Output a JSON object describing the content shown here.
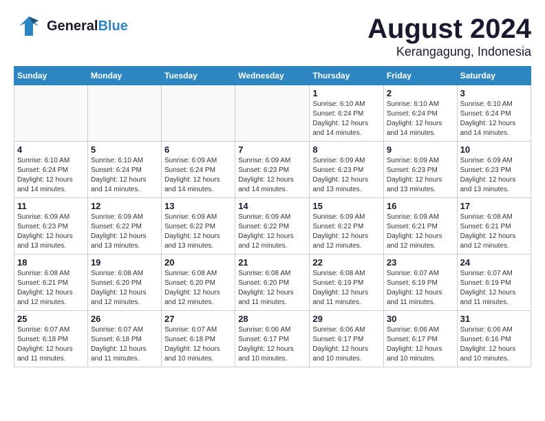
{
  "header": {
    "logo_general": "General",
    "logo_blue": "Blue",
    "month_year": "August 2024",
    "location": "Kerangagung, Indonesia"
  },
  "weekdays": [
    "Sunday",
    "Monday",
    "Tuesday",
    "Wednesday",
    "Thursday",
    "Friday",
    "Saturday"
  ],
  "weeks": [
    [
      {
        "day": "",
        "info": "",
        "empty": true
      },
      {
        "day": "",
        "info": "",
        "empty": true
      },
      {
        "day": "",
        "info": "",
        "empty": true
      },
      {
        "day": "",
        "info": "",
        "empty": true
      },
      {
        "day": "1",
        "info": "Sunrise: 6:10 AM\nSunset: 6:24 PM\nDaylight: 12 hours\nand 14 minutes.",
        "empty": false
      },
      {
        "day": "2",
        "info": "Sunrise: 6:10 AM\nSunset: 6:24 PM\nDaylight: 12 hours\nand 14 minutes.",
        "empty": false
      },
      {
        "day": "3",
        "info": "Sunrise: 6:10 AM\nSunset: 6:24 PM\nDaylight: 12 hours\nand 14 minutes.",
        "empty": false
      }
    ],
    [
      {
        "day": "4",
        "info": "Sunrise: 6:10 AM\nSunset: 6:24 PM\nDaylight: 12 hours\nand 14 minutes.",
        "empty": false
      },
      {
        "day": "5",
        "info": "Sunrise: 6:10 AM\nSunset: 6:24 PM\nDaylight: 12 hours\nand 14 minutes.",
        "empty": false
      },
      {
        "day": "6",
        "info": "Sunrise: 6:09 AM\nSunset: 6:24 PM\nDaylight: 12 hours\nand 14 minutes.",
        "empty": false
      },
      {
        "day": "7",
        "info": "Sunrise: 6:09 AM\nSunset: 6:23 PM\nDaylight: 12 hours\nand 14 minutes.",
        "empty": false
      },
      {
        "day": "8",
        "info": "Sunrise: 6:09 AM\nSunset: 6:23 PM\nDaylight: 12 hours\nand 13 minutes.",
        "empty": false
      },
      {
        "day": "9",
        "info": "Sunrise: 6:09 AM\nSunset: 6:23 PM\nDaylight: 12 hours\nand 13 minutes.",
        "empty": false
      },
      {
        "day": "10",
        "info": "Sunrise: 6:09 AM\nSunset: 6:23 PM\nDaylight: 12 hours\nand 13 minutes.",
        "empty": false
      }
    ],
    [
      {
        "day": "11",
        "info": "Sunrise: 6:09 AM\nSunset: 6:23 PM\nDaylight: 12 hours\nand 13 minutes.",
        "empty": false
      },
      {
        "day": "12",
        "info": "Sunrise: 6:09 AM\nSunset: 6:22 PM\nDaylight: 12 hours\nand 13 minutes.",
        "empty": false
      },
      {
        "day": "13",
        "info": "Sunrise: 6:09 AM\nSunset: 6:22 PM\nDaylight: 12 hours\nand 13 minutes.",
        "empty": false
      },
      {
        "day": "14",
        "info": "Sunrise: 6:09 AM\nSunset: 6:22 PM\nDaylight: 12 hours\nand 12 minutes.",
        "empty": false
      },
      {
        "day": "15",
        "info": "Sunrise: 6:09 AM\nSunset: 6:22 PM\nDaylight: 12 hours\nand 12 minutes.",
        "empty": false
      },
      {
        "day": "16",
        "info": "Sunrise: 6:09 AM\nSunset: 6:21 PM\nDaylight: 12 hours\nand 12 minutes.",
        "empty": false
      },
      {
        "day": "17",
        "info": "Sunrise: 6:08 AM\nSunset: 6:21 PM\nDaylight: 12 hours\nand 12 minutes.",
        "empty": false
      }
    ],
    [
      {
        "day": "18",
        "info": "Sunrise: 6:08 AM\nSunset: 6:21 PM\nDaylight: 12 hours\nand 12 minutes.",
        "empty": false
      },
      {
        "day": "19",
        "info": "Sunrise: 6:08 AM\nSunset: 6:20 PM\nDaylight: 12 hours\nand 12 minutes.",
        "empty": false
      },
      {
        "day": "20",
        "info": "Sunrise: 6:08 AM\nSunset: 6:20 PM\nDaylight: 12 hours\nand 12 minutes.",
        "empty": false
      },
      {
        "day": "21",
        "info": "Sunrise: 6:08 AM\nSunset: 6:20 PM\nDaylight: 12 hours\nand 11 minutes.",
        "empty": false
      },
      {
        "day": "22",
        "info": "Sunrise: 6:08 AM\nSunset: 6:19 PM\nDaylight: 12 hours\nand 11 minutes.",
        "empty": false
      },
      {
        "day": "23",
        "info": "Sunrise: 6:07 AM\nSunset: 6:19 PM\nDaylight: 12 hours\nand 11 minutes.",
        "empty": false
      },
      {
        "day": "24",
        "info": "Sunrise: 6:07 AM\nSunset: 6:19 PM\nDaylight: 12 hours\nand 11 minutes.",
        "empty": false
      }
    ],
    [
      {
        "day": "25",
        "info": "Sunrise: 6:07 AM\nSunset: 6:18 PM\nDaylight: 12 hours\nand 11 minutes.",
        "empty": false
      },
      {
        "day": "26",
        "info": "Sunrise: 6:07 AM\nSunset: 6:18 PM\nDaylight: 12 hours\nand 11 minutes.",
        "empty": false
      },
      {
        "day": "27",
        "info": "Sunrise: 6:07 AM\nSunset: 6:18 PM\nDaylight: 12 hours\nand 10 minutes.",
        "empty": false
      },
      {
        "day": "28",
        "info": "Sunrise: 6:06 AM\nSunset: 6:17 PM\nDaylight: 12 hours\nand 10 minutes.",
        "empty": false
      },
      {
        "day": "29",
        "info": "Sunrise: 6:06 AM\nSunset: 6:17 PM\nDaylight: 12 hours\nand 10 minutes.",
        "empty": false
      },
      {
        "day": "30",
        "info": "Sunrise: 6:06 AM\nSunset: 6:17 PM\nDaylight: 12 hours\nand 10 minutes.",
        "empty": false
      },
      {
        "day": "31",
        "info": "Sunrise: 6:06 AM\nSunset: 6:16 PM\nDaylight: 12 hours\nand 10 minutes.",
        "empty": false
      }
    ]
  ]
}
